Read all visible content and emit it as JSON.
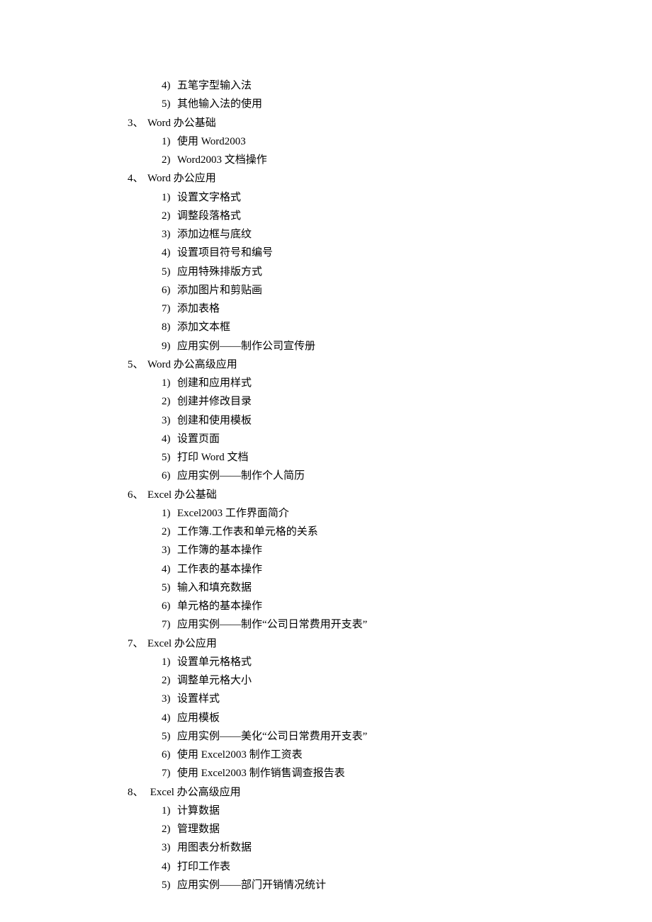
{
  "outline": [
    {
      "type": "sub",
      "marker": "4)",
      "text": "五笔字型输入法"
    },
    {
      "type": "sub",
      "marker": "5)",
      "text": "其他输入法的使用"
    },
    {
      "type": "section",
      "marker": "3、",
      "text": "Word 办公基础"
    },
    {
      "type": "sub",
      "marker": "1)",
      "text": "使用 Word2003"
    },
    {
      "type": "sub",
      "marker": "2)",
      "text": "Word2003 文档操作"
    },
    {
      "type": "section",
      "marker": "4、",
      "text": "Word 办公应用"
    },
    {
      "type": "sub",
      "marker": "1)",
      "text": "设置文字格式"
    },
    {
      "type": "sub",
      "marker": "2)",
      "text": "调整段落格式"
    },
    {
      "type": "sub",
      "marker": "3)",
      "text": "添加边框与底纹"
    },
    {
      "type": "sub",
      "marker": "4)",
      "text": "设置项目符号和编号"
    },
    {
      "type": "sub",
      "marker": "5)",
      "text": "应用特殊排版方式"
    },
    {
      "type": "sub",
      "marker": "6)",
      "text": "添加图片和剪贴画"
    },
    {
      "type": "sub",
      "marker": "7)",
      "text": "添加表格"
    },
    {
      "type": "sub",
      "marker": "8)",
      "text": "添加文本框"
    },
    {
      "type": "sub",
      "marker": "9)",
      "text": "应用实例——制作公司宣传册"
    },
    {
      "type": "section",
      "marker": "5、",
      "text": "Word 办公高级应用"
    },
    {
      "type": "sub",
      "marker": "1)",
      "text": "创建和应用样式"
    },
    {
      "type": "sub",
      "marker": "2)",
      "text": "创建并修改目录"
    },
    {
      "type": "sub",
      "marker": "3)",
      "text": "创建和使用模板"
    },
    {
      "type": "sub",
      "marker": "4)",
      "text": "设置页面"
    },
    {
      "type": "sub",
      "marker": "5)",
      "text": "打印 Word 文档"
    },
    {
      "type": "sub",
      "marker": "6)",
      "text": "应用实例——制作个人简历"
    },
    {
      "type": "section",
      "marker": "6、",
      "text": "Excel 办公基础"
    },
    {
      "type": "sub",
      "marker": "1)",
      "text": "Excel2003 工作界面简介"
    },
    {
      "type": "sub",
      "marker": "2)",
      "text": "工作簿.工作表和单元格的关系"
    },
    {
      "type": "sub",
      "marker": "3)",
      "text": "工作簿的基本操作"
    },
    {
      "type": "sub",
      "marker": "4)",
      "text": "工作表的基本操作"
    },
    {
      "type": "sub",
      "marker": "5)",
      "text": "输入和填充数据"
    },
    {
      "type": "sub",
      "marker": "6)",
      "text": "单元格的基本操作"
    },
    {
      "type": "sub",
      "marker": "7)",
      "text": "应用实例——制作“公司日常费用开支表”"
    },
    {
      "type": "section",
      "marker": "7、",
      "text": "Excel 办公应用"
    },
    {
      "type": "sub",
      "marker": "1)",
      "text": "设置单元格格式"
    },
    {
      "type": "sub",
      "marker": "2)",
      "text": "调整单元格大小"
    },
    {
      "type": "sub",
      "marker": "3)",
      "text": "设置样式"
    },
    {
      "type": "sub",
      "marker": "4)",
      "text": "应用模板"
    },
    {
      "type": "sub",
      "marker": "5)",
      "text": "应用实例——美化“公司日常费用开支表”"
    },
    {
      "type": "sub",
      "marker": "6)",
      "text": "使用 Excel2003 制作工资表"
    },
    {
      "type": "sub",
      "marker": "7)",
      "text": "使用 Excel2003 制作销售调查报告表"
    },
    {
      "type": "section",
      "marker": "8、",
      "text": " Excel 办公高级应用"
    },
    {
      "type": "sub",
      "marker": "1)",
      "text": "计算数据"
    },
    {
      "type": "sub",
      "marker": "2)",
      "text": "管理数据"
    },
    {
      "type": "sub",
      "marker": "3)",
      "text": "用图表分析数据"
    },
    {
      "type": "sub",
      "marker": "4)",
      "text": "打印工作表"
    },
    {
      "type": "sub",
      "marker": "5)",
      "text": "应用实例——部门开销情况统计"
    }
  ]
}
